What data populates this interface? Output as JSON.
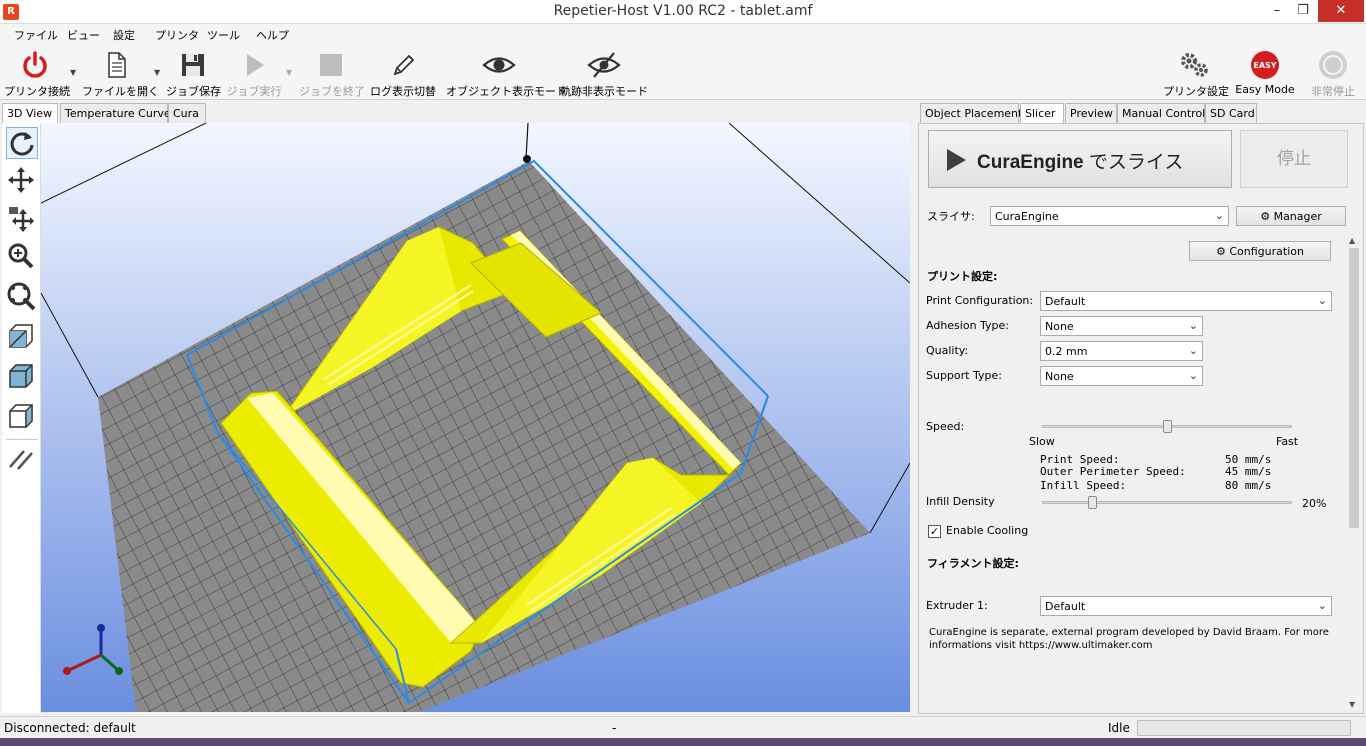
{
  "window": {
    "title": "Repetier-Host V1.00 RC2 - tablet.amf",
    "app_icon": "R",
    "minimize": "–",
    "maximize": "❐",
    "close": "✕"
  },
  "menu": [
    "ファイル",
    "ビュー",
    "設定",
    "プリンタ",
    "ツール",
    "ヘルプ"
  ],
  "toolbar": {
    "connect": "プリンタ接続",
    "open_file": "ファイルを開く",
    "save_job": "ジョブ保存",
    "run_job": "ジョブ実行",
    "stop_job": "ジョブを終了",
    "toggle_log": "ログ表示切替",
    "object_mode": "オブジェクト表示モード",
    "hide_path_mode": "軌跡非表示モード",
    "printer_settings": "プリンタ設定",
    "easy_mode": "Easy Mode",
    "easy_badge": "EASY",
    "emergency_stop": "非常停止"
  },
  "left_tabs": [
    "3D View",
    "Temperature Curve",
    "Cura"
  ],
  "right_tabs": [
    "Object Placement",
    "Slicer",
    "Preview",
    "Manual Control",
    "SD Card"
  ],
  "slicer": {
    "slice_button_main": "CuraEngine",
    "slice_button_suffix": " でスライス",
    "stop_button": "停止",
    "slicer_label": "スライサ:",
    "slicer_value": "CuraEngine",
    "manager_button": "Manager",
    "configuration_button": "Configuration",
    "print_settings_header": "プリント設定:",
    "print_config_label": "Print Configuration:",
    "print_config_value": "Default",
    "adhesion_label": "Adhesion Type:",
    "adhesion_value": "None",
    "quality_label": "Quality:",
    "quality_value": "0.2 mm",
    "support_label": "Support Type:",
    "support_value": "None",
    "speed_label": "Speed:",
    "speed_slow": "Slow",
    "speed_fast": "Fast",
    "speed_slider_level": 0.5,
    "print_speed_label": "Print Speed:",
    "print_speed_value": "50 mm/s",
    "outer_speed_label": "Outer Perimeter Speed:",
    "outer_speed_value": "45 mm/s",
    "infill_speed_label": "Infill Speed:",
    "infill_speed_value": "80 mm/s",
    "infill_density_label": "Infill Density",
    "infill_density_value": "20%",
    "infill_density_level": 0.2,
    "cooling_label": "Enable Cooling",
    "cooling_checked": true,
    "filament_header": "フィラメント設定:",
    "extruder_label": "Extruder 1:",
    "extruder_value": "Default",
    "footer_line1": "CuraEngine is separate, external program developed by David Braam. For more",
    "footer_line2": "informations visit https://www.ultimaker.com"
  },
  "status": {
    "left": "Disconnected: default",
    "mid": "-",
    "right": "Idle"
  },
  "colors": {
    "model": "#f2f200",
    "bed": "#8a8a8a",
    "sky_top": "#f3f7ff",
    "sky_bottom": "#6a8ee0",
    "bbox": "#2a8ae6",
    "accent_red": "#d61d1d"
  }
}
